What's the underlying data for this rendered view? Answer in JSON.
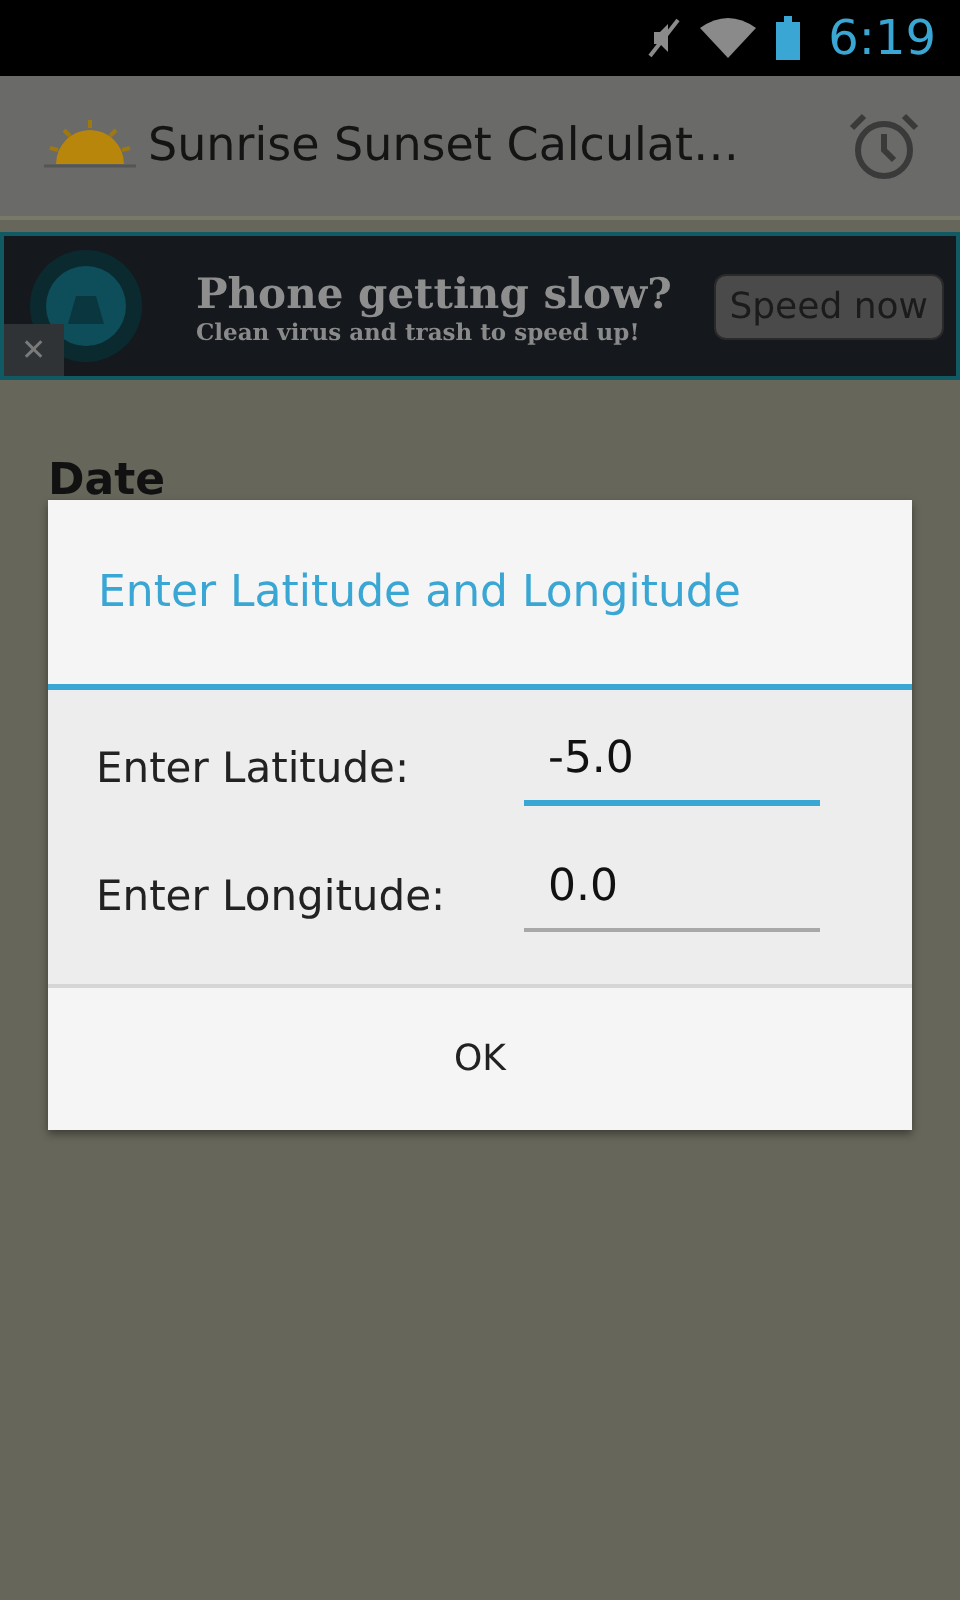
{
  "status_bar": {
    "time": "6:19"
  },
  "action_bar": {
    "title": "Sunrise Sunset Calculat…"
  },
  "ad": {
    "close": "✕",
    "headline": "Phone getting slow?",
    "subline": "Clean virus and trash to speed up!",
    "button": "Speed now"
  },
  "page": {
    "section_label": "Date"
  },
  "dialog": {
    "title": "Enter Latitude and Longitude",
    "fields": [
      {
        "label": "Enter Latitude:",
        "value": "-5.0",
        "focused": true
      },
      {
        "label": "Enter Longitude:",
        "value": "0.0",
        "focused": false
      }
    ],
    "button": "OK"
  }
}
